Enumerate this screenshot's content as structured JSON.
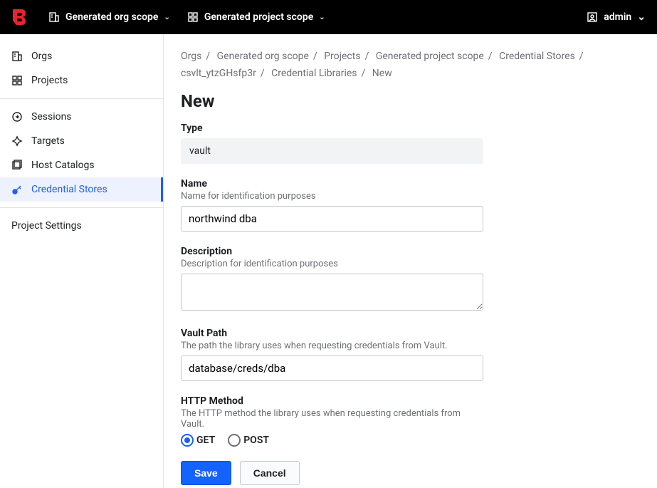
{
  "topbar": {
    "org_scope_label": "Generated org scope",
    "project_scope_label": "Generated project scope",
    "user_label": "admin"
  },
  "sidebar": {
    "items": [
      {
        "label": "Orgs"
      },
      {
        "label": "Projects"
      },
      {
        "label": "Sessions"
      },
      {
        "label": "Targets"
      },
      {
        "label": "Host Catalogs"
      },
      {
        "label": "Credential Stores"
      },
      {
        "label": "Project Settings"
      }
    ]
  },
  "breadcrumbs": {
    "items": [
      "Orgs",
      "Generated org scope",
      "Projects",
      "Generated project scope",
      "Credential Stores",
      "csvlt_ytzGHsfp3r",
      "Credential Libraries",
      "New"
    ]
  },
  "page": {
    "title": "New"
  },
  "form": {
    "type_label": "Type",
    "type_value": "vault",
    "name_label": "Name",
    "name_help": "Name for identification purposes",
    "name_value": "northwind dba",
    "desc_label": "Description",
    "desc_help": "Description for identification purposes",
    "desc_value": "",
    "path_label": "Vault Path",
    "path_help": "The path the library uses when requesting credentials from Vault.",
    "path_value": "database/creds/dba",
    "method_label": "HTTP Method",
    "method_help": "The HTTP method the library uses when requesting credentials from Vault.",
    "method_options": {
      "get": "GET",
      "post": "POST"
    },
    "method_selected": "GET",
    "save_label": "Save",
    "cancel_label": "Cancel"
  }
}
